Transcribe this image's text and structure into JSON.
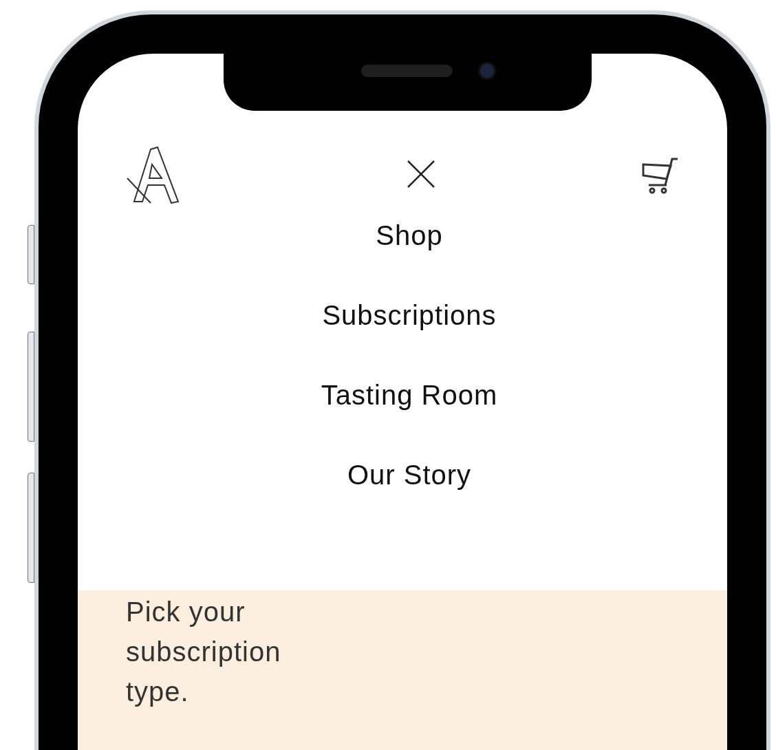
{
  "nav_menu": {
    "items": [
      {
        "label": "Shop"
      },
      {
        "label": "Subscriptions"
      },
      {
        "label": "Tasting Room"
      },
      {
        "label": "Our Story"
      }
    ]
  },
  "hero": {
    "heading": "Pick your subscription type."
  }
}
